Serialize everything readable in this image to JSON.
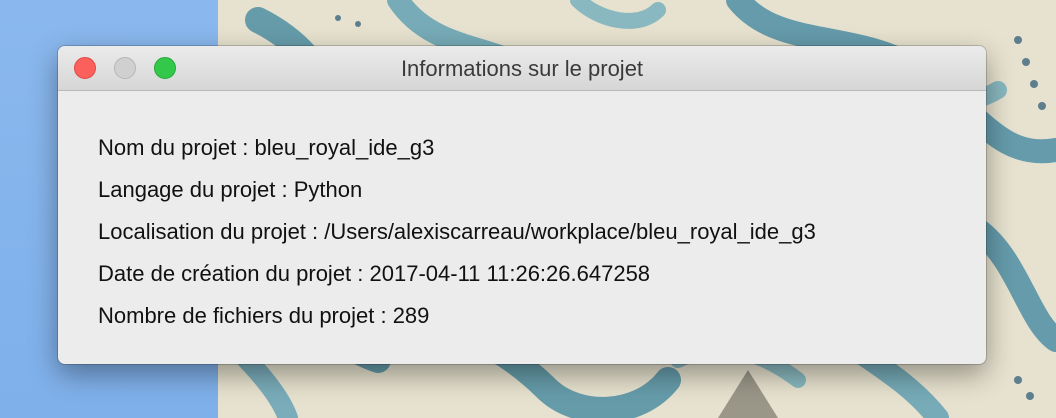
{
  "window": {
    "title": "Informations sur le projet"
  },
  "project_info": {
    "name_line": "Nom du projet : bleu_royal_ide_g3",
    "language_line": "Langage du projet : Python",
    "location_line": "Localisation du projet : /Users/alexiscarreau/workplace/bleu_royal_ide_g3",
    "created_line": "Date de création du projet : 2017-04-11 11:26:26.647258",
    "file_count_line": "Nombre de fichiers du projet : 289"
  },
  "colors": {
    "desktop_blue": "#8ab8ee",
    "close_button": "#fc605c",
    "minimize_button": "#d0d0d0",
    "zoom_button": "#34c84a",
    "window_background": "#ececec"
  }
}
